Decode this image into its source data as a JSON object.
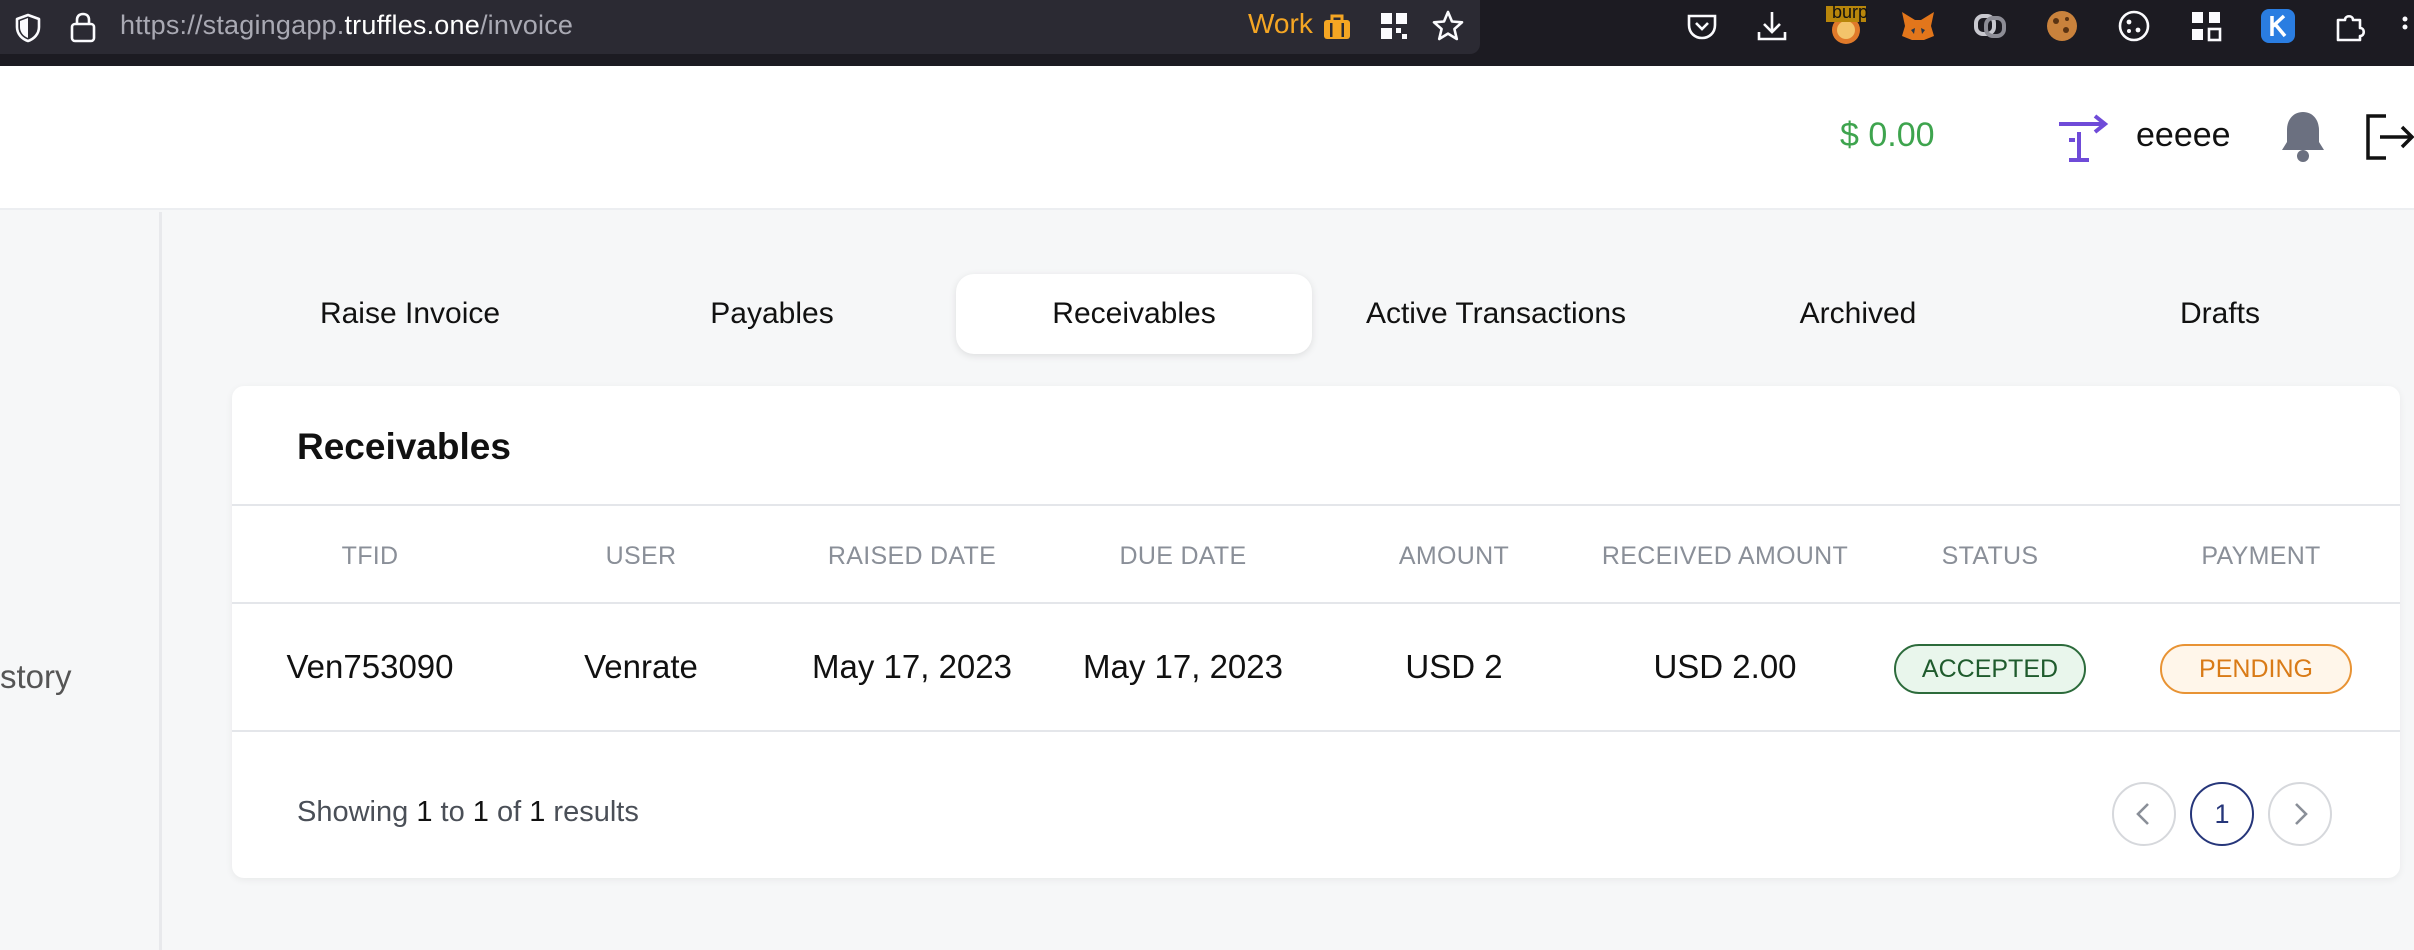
{
  "browser": {
    "url_prefix": "https://stagingapp.",
    "url_domain": "truffles.one",
    "url_path": "/invoice",
    "container_label": "Work",
    "extension_badge": "burp",
    "colors": {
      "container": "#f5a623",
      "bar": "#1c1b22"
    }
  },
  "header": {
    "balance": "$ 0.00",
    "username": "eeeee",
    "colors": {
      "balance": "#3ea44e",
      "accent": "#6f4bd8"
    }
  },
  "sidebar": {
    "partial_item": "story"
  },
  "tabs": [
    {
      "label": "Raise Invoice",
      "active": false
    },
    {
      "label": "Payables",
      "active": false
    },
    {
      "label": "Receivables",
      "active": true
    },
    {
      "label": "Active Transactions",
      "active": false
    },
    {
      "label": "Archived",
      "active": false
    },
    {
      "label": "Drafts",
      "active": false
    }
  ],
  "card": {
    "title": "Receivables",
    "columns": [
      "TFID",
      "USER",
      "RAISED DATE",
      "DUE DATE",
      "AMOUNT",
      "RECEIVED AMOUNT",
      "STATUS",
      "PAYMENT"
    ],
    "rows": [
      {
        "tfid": "Ven753090",
        "user": "Venrate",
        "raised_date": "May 17, 2023",
        "due_date": "May 17, 2023",
        "amount": "USD 2",
        "received_amount": "USD 2.00",
        "status": "ACCEPTED",
        "payment": "PENDING"
      }
    ],
    "pagination": {
      "prefix": "Showing",
      "from": "1",
      "to_word": "to",
      "to": "1",
      "of_word": "of",
      "total": "1",
      "suffix": "results",
      "current_page": "1"
    },
    "colors": {
      "accepted": "#2c6b3b",
      "pending": "#e89334",
      "page": "#26367a"
    }
  }
}
